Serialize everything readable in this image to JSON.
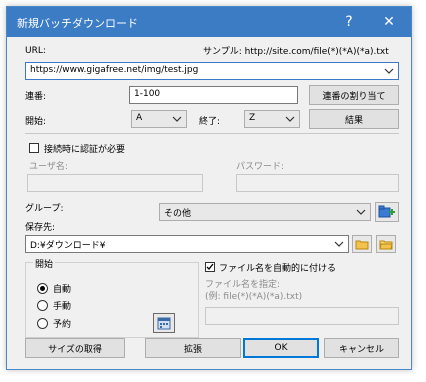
{
  "window": {
    "title": "新規バッチダウンロード",
    "help_glyph": "?",
    "close_glyph": "✕"
  },
  "url": {
    "label": "URL:",
    "sample": "サンプル: http://site.com/file(*)(*A)(*a).txt",
    "value": "https://www.gigafree.net/img/test.jpg"
  },
  "sequence": {
    "label": "連番:",
    "value": "1-100",
    "assign_button": "連番の割り当て"
  },
  "range": {
    "start_label": "開始:",
    "start_value": "A",
    "end_label": "終了:",
    "end_value": "Z",
    "result_button": "結果"
  },
  "auth": {
    "checkbox_label": "接続時に認証が必要",
    "user_label": "ユーザ名:",
    "user_value": "",
    "password_label": "パスワード:",
    "password_value": ""
  },
  "group": {
    "label": "グループ:",
    "value": "その他"
  },
  "save_to": {
    "label": "保存先:",
    "value": "D:¥ダウンロード¥"
  },
  "start": {
    "legend": "開始",
    "options": [
      "自動",
      "手動",
      "予約"
    ],
    "selected": "自動"
  },
  "filename": {
    "auto_label": "ファイル名を自動的に付ける",
    "auto_checked": true,
    "specify_label": "ファイル名を指定:",
    "example": "(例: file(*)(*A)(*a).txt)",
    "value": ""
  },
  "buttons": {
    "get_size": "サイズの取得",
    "expand": "拡張",
    "ok": "OK",
    "cancel": "キャンセル"
  },
  "icons": {
    "add_group": "add-folder-icon",
    "folder_open": "folder-icon",
    "folder_browse": "folder-browse-icon",
    "calendar": "calendar-icon"
  },
  "colors": {
    "titlebar": "#3b7cc4",
    "accent": "#0078d7"
  }
}
